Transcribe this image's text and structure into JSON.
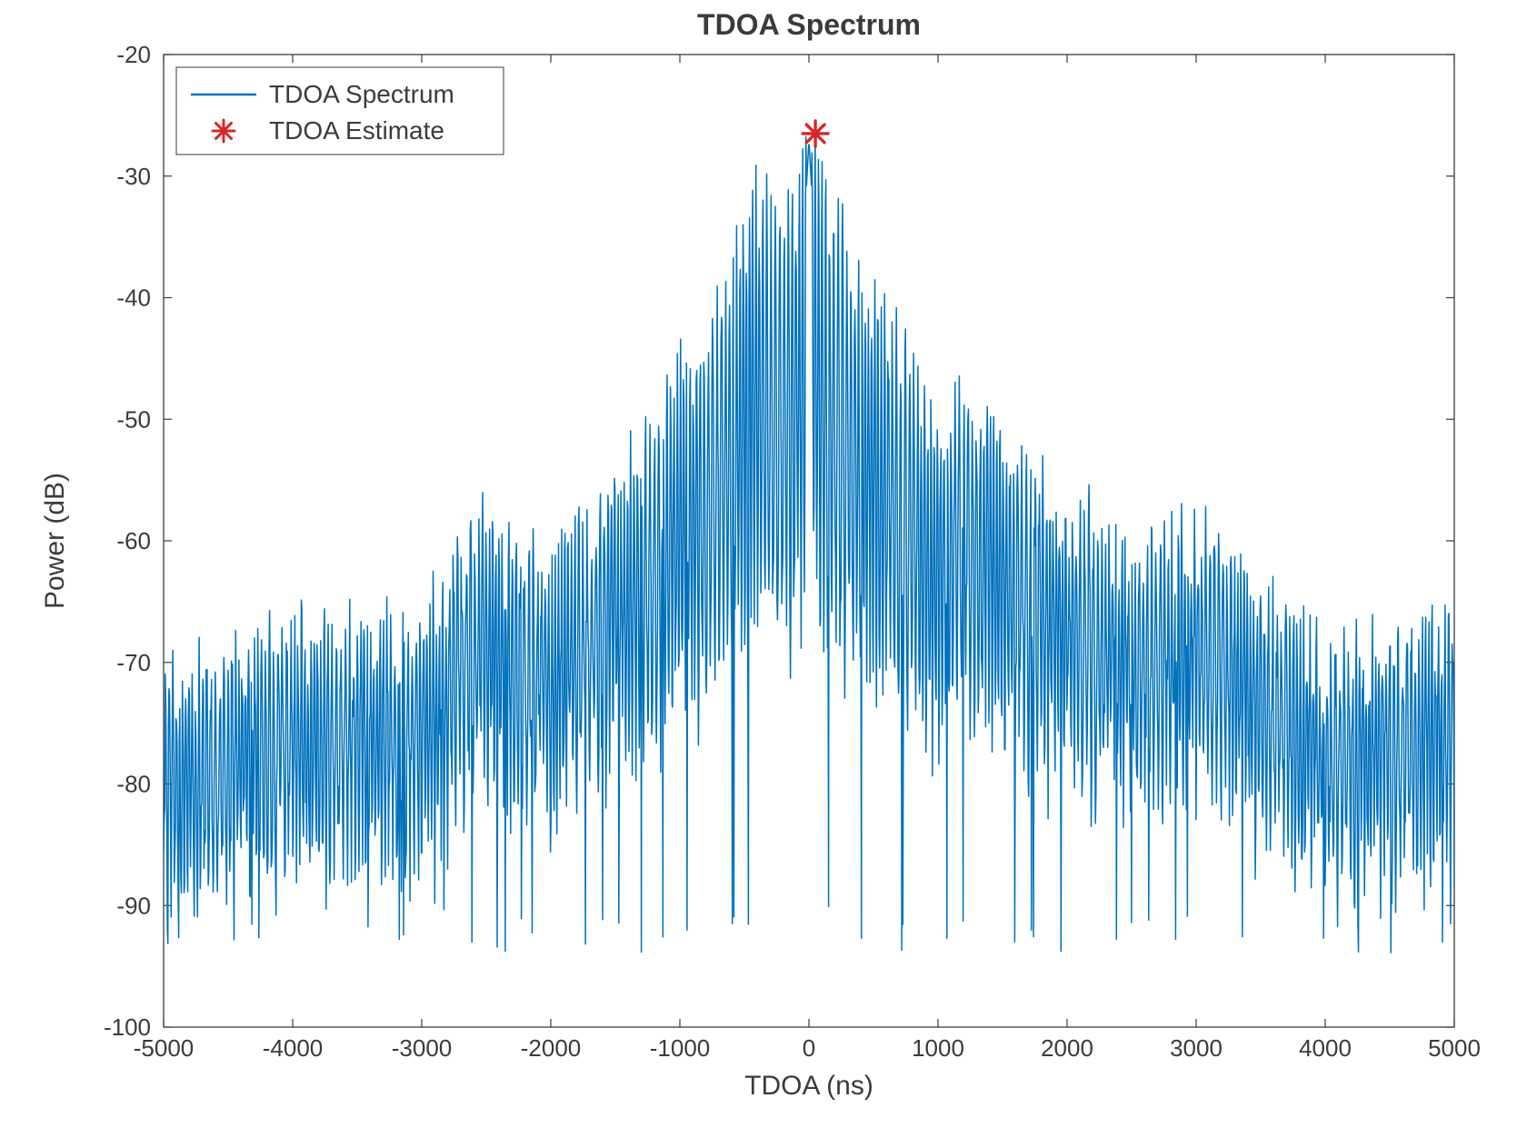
{
  "chart_data": {
    "type": "line",
    "title": "TDOA Spectrum",
    "xlabel": "TDOA (ns)",
    "ylabel": "Power (dB)",
    "xlim": [
      -5000,
      5000
    ],
    "ylim": [
      -100,
      -20
    ],
    "xticks": [
      -5000,
      -4000,
      -3000,
      -2000,
      -1000,
      0,
      1000,
      2000,
      3000,
      4000,
      5000
    ],
    "yticks": [
      -100,
      -90,
      -80,
      -70,
      -60,
      -50,
      -40,
      -30,
      -20
    ],
    "series": [
      {
        "name": "TDOA Spectrum",
        "color": "#0072BD",
        "style": "line",
        "description": "Cross-correlation power spectrum; dense noisy oscillations with baseline ≈ -76 dB on the far wings, rising envelope toward the center, peak lobes near TDOA≈0 reaching ≈ -27 dB, strong sidelobes falling off on each side.",
        "envelope_samples_x": [
          -5000,
          -4000,
          -3000,
          -2500,
          -2000,
          -1500,
          -1200,
          -1000,
          -800,
          -600,
          -400,
          -200,
          -100,
          0,
          50,
          100,
          200,
          400,
          600,
          800,
          1000,
          1200,
          1500,
          2000,
          2500,
          3000,
          4000,
          5000
        ],
        "envelope_top_db": [
          -72,
          -68,
          -68,
          -59,
          -64,
          -56,
          -52,
          -46,
          -45,
          -38,
          -32,
          -34,
          -32,
          -27,
          -27,
          -32,
          -34,
          -40,
          -43,
          -46,
          -52,
          -48,
          -52,
          -58,
          -62,
          -60,
          -70,
          -68
        ],
        "noise_floor_db": -88,
        "noise_top_db": -70
      },
      {
        "name": "TDOA Estimate",
        "color": "#D62728",
        "style": "marker-asterisk",
        "x": [
          50
        ],
        "y": [
          -26.5
        ]
      }
    ],
    "legend": {
      "position": "upper-left-inside",
      "entries": [
        "TDOA Spectrum",
        "TDOA Estimate"
      ]
    }
  },
  "xtick_labels": {
    "t0": "-5000",
    "t1": "-4000",
    "t2": "-3000",
    "t3": "-2000",
    "t4": "-1000",
    "t5": "0",
    "t6": "1000",
    "t7": "2000",
    "t8": "3000",
    "t9": "4000",
    "t10": "5000"
  },
  "ytick_labels": {
    "y0": "-100",
    "y1": "-90",
    "y2": "-80",
    "y3": "-70",
    "y4": "-60",
    "y5": "-50",
    "y6": "-40",
    "y7": "-30",
    "y8": "-20"
  }
}
